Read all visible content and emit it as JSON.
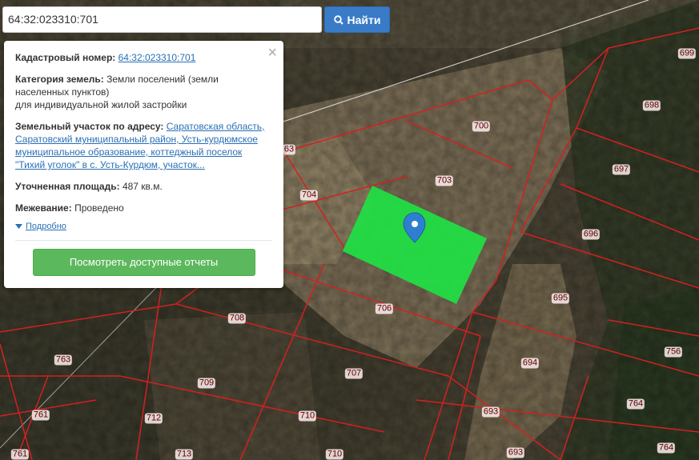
{
  "search": {
    "value": "64:32:023310:701",
    "button_label": "Найти"
  },
  "popup": {
    "cadastral_label": "Кадастровый номер:",
    "cadastral_value": "64:32:023310:701",
    "category_label": "Категория земель:",
    "category_value": "Земли поселений (земли населенных пунктов)",
    "category_value2": "для индивидуальной жилой застройки",
    "address_label": "Земельный участок по адресу:",
    "address_value": "Саратовская область, Саратовский муниципальный район, Усть-курдюмское муниципальное образование, коттеджный поселок \"Тихий уголок\" в с. Усть-Курдюм, участок...",
    "area_label": "Уточненная площадь:",
    "area_value": "487 кв.м.",
    "survey_label": "Межевание:",
    "survey_value": "Проведено",
    "more_label": "Подробно",
    "report_button": "Посмотреть доступные отчеты"
  },
  "map": {
    "highlight_color": "#22dd44",
    "boundary_color": "#d42020",
    "parcel_labels": [
      "699",
      "698",
      "700",
      "703",
      "697",
      "63",
      "704",
      "696",
      "706",
      "695",
      "708",
      "756",
      "763",
      "707",
      "694",
      "709",
      "764",
      "712",
      "761",
      "710",
      "693",
      "764",
      "761",
      "713",
      "710",
      "693"
    ]
  }
}
